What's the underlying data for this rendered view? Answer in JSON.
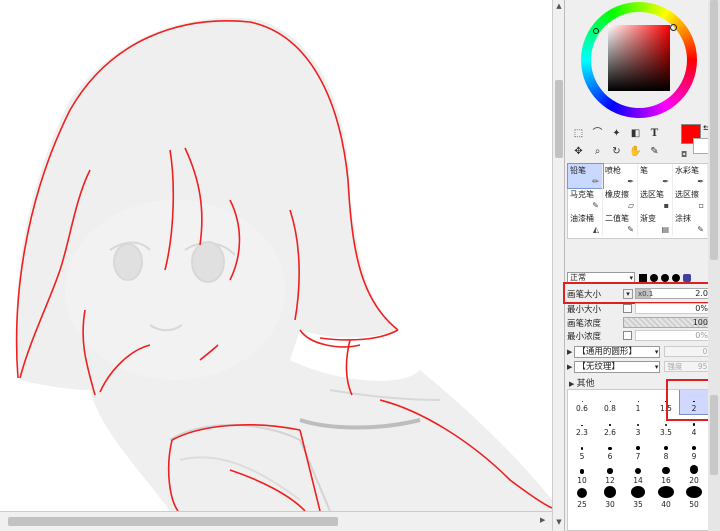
{
  "canvas": {
    "description_icon": "anime-girl-lineart"
  },
  "tools": {
    "row1": [
      "select-rect-icon",
      "lasso-icon",
      "magic-wand-icon",
      "layer-select-icon",
      "text-tool-icon"
    ],
    "row1_glyphs": [
      "⬚",
      "⌒",
      "✦",
      "◧",
      "T"
    ],
    "row2": [
      "move-icon",
      "zoom-icon",
      "rotate-icon",
      "hand-icon",
      "eyedropper-icon"
    ],
    "row2_glyphs": [
      "✥",
      "⌕",
      "↻",
      "✋",
      "✎"
    ],
    "foreground_color": "#ff0000",
    "background_color": "#ffffff"
  },
  "brushes": [
    {
      "label": "铅笔",
      "icon": "✏",
      "selected": true
    },
    {
      "label": "喷枪",
      "icon": "✒",
      "selected": false
    },
    {
      "label": "笔",
      "icon": "✒",
      "selected": false
    },
    {
      "label": "水彩笔",
      "icon": "✒",
      "selected": false
    },
    {
      "label": "马克笔",
      "icon": "✎",
      "selected": false
    },
    {
      "label": "橡皮擦",
      "icon": "▱",
      "selected": false
    },
    {
      "label": "选区笔",
      "icon": "▪",
      "selected": false
    },
    {
      "label": "选区擦",
      "icon": "▫",
      "selected": false
    },
    {
      "label": "油漆桶",
      "icon": "◭",
      "selected": false
    },
    {
      "label": "二值笔",
      "icon": "✎",
      "selected": false
    },
    {
      "label": "渐变",
      "icon": "▤",
      "selected": false
    },
    {
      "label": "涂抹",
      "icon": "✎",
      "selected": false
    }
  ],
  "blend_mode": "正常",
  "params": {
    "brush_size_label": "画笔大小",
    "brush_size_multiplier": "x0.1",
    "brush_size_value": "2.0",
    "min_size_label": "最小大小",
    "min_size_value": "0%",
    "density_label": "画笔浓度",
    "density_value": "100",
    "min_density_label": "最小浓度",
    "min_density_value": "0%"
  },
  "dropdowns": {
    "shape": "【通用的圆形】",
    "shape_value": "0",
    "texture": "【无纹理】",
    "texture_value_label": "强度",
    "texture_value": "95"
  },
  "other_label": "其他",
  "sizes": [
    "0.6",
    "0.8",
    "1",
    "1.5",
    "2",
    "2.3",
    "2.6",
    "3",
    "3.5",
    "4",
    "5",
    "6",
    "7",
    "8",
    "9",
    "10",
    "12",
    "14",
    "16",
    "20",
    "25",
    "30",
    "35",
    "40",
    "50"
  ],
  "selected_size": "2"
}
